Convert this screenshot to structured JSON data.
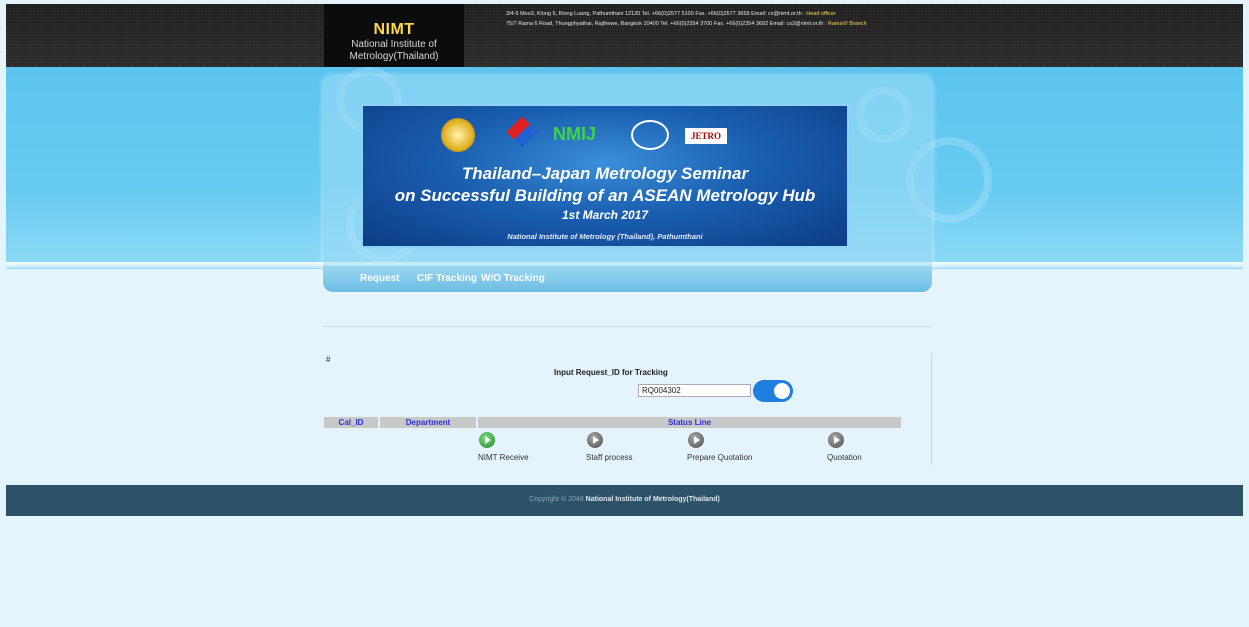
{
  "header": {
    "logo_title": "NIMT",
    "logo_sub1": "National Institute of",
    "logo_sub2": "Metrology(Thailand)",
    "address1": "3/4-5 Moo3, Klong 5, Klong Luang, Pathumthani 12120 Tel. +66(0)2577 5100 Fax. +66(0)2577 3659 Email: cs@nimt.or.th : ",
    "address1_branch": "Head officer",
    "address2": "75/7 Rama 6 Road, Thungphyathai, Rajthewe, Bangkok 10400 Tel. +66(0)2354 3700 Fax. +66(0)2354 3692 Email: cs2@nimt.or.th : ",
    "address2_branch": "RamaVI Branch"
  },
  "banner": {
    "logo_nmij": "NMIJ",
    "logo_jetro": "JETRO",
    "line1": "Thailand–Japan Metrology Seminar",
    "line2": "on Successful Building of an ASEAN Metrology Hub",
    "line3": "1st March 2017",
    "line4": "National Institute of Metrology (Thailand), Pathumthani"
  },
  "nav": {
    "items": [
      {
        "label": "Request"
      },
      {
        "label": "CIF Tracking"
      },
      {
        "label": "W/O Tracking"
      }
    ]
  },
  "tracking": {
    "hash": "#",
    "label": "Input Request_ID for Tracking",
    "request_id": "RQ004302",
    "toggle_on": true
  },
  "table": {
    "headers": [
      "Cal_ID",
      "Department",
      "Status Line"
    ],
    "steps": [
      {
        "label": "NIMT Receive",
        "status": "done"
      },
      {
        "label": "Staff process",
        "status": "pending"
      },
      {
        "label": "Prepare Quotation",
        "status": "pending"
      },
      {
        "label": "Quotation",
        "status": "pending"
      }
    ]
  },
  "footer": {
    "copyright": "Copyright © 2048",
    "org": "National Institute of Metrology(Thailand)"
  },
  "colors": {
    "accent": "#1e7fe0",
    "logo_yellow": "#ffd94a",
    "footer_bg": "#2c5268",
    "header_link_blue": "#2a32d8"
  }
}
